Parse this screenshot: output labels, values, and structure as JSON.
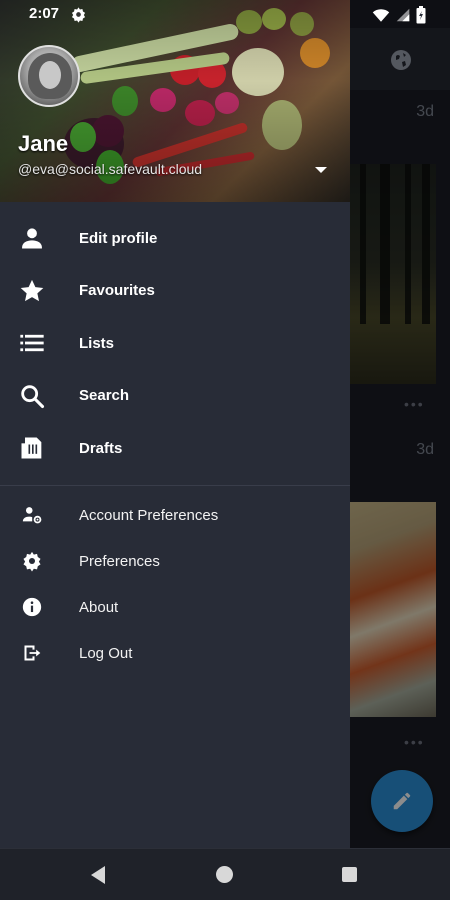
{
  "status_bar": {
    "time": "2:07",
    "icons": [
      "gear-icon",
      "wifi-icon",
      "signal-icon",
      "battery-icon"
    ]
  },
  "account": {
    "display_name": "Jane",
    "handle": "@eva@social.safevault.cloud"
  },
  "menu": {
    "primary": [
      {
        "label": "Edit profile",
        "icon": "person-icon"
      },
      {
        "label": "Favourites",
        "icon": "star-icon"
      },
      {
        "label": "Lists",
        "icon": "list-icon"
      },
      {
        "label": "Search",
        "icon": "search-icon"
      },
      {
        "label": "Drafts",
        "icon": "drafts-icon"
      }
    ],
    "secondary": [
      {
        "label": "Account Preferences",
        "icon": "account-settings-icon"
      },
      {
        "label": "Preferences",
        "icon": "gear-icon"
      },
      {
        "label": "About",
        "icon": "info-icon"
      },
      {
        "label": "Log Out",
        "icon": "logout-icon"
      }
    ]
  },
  "timeline": {
    "timestamps": [
      "3d",
      "3d"
    ],
    "more": "•••"
  },
  "colors": {
    "drawer_bg": "#282c37",
    "accent_fab": "#2b90d9",
    "text": "#ffffff"
  }
}
